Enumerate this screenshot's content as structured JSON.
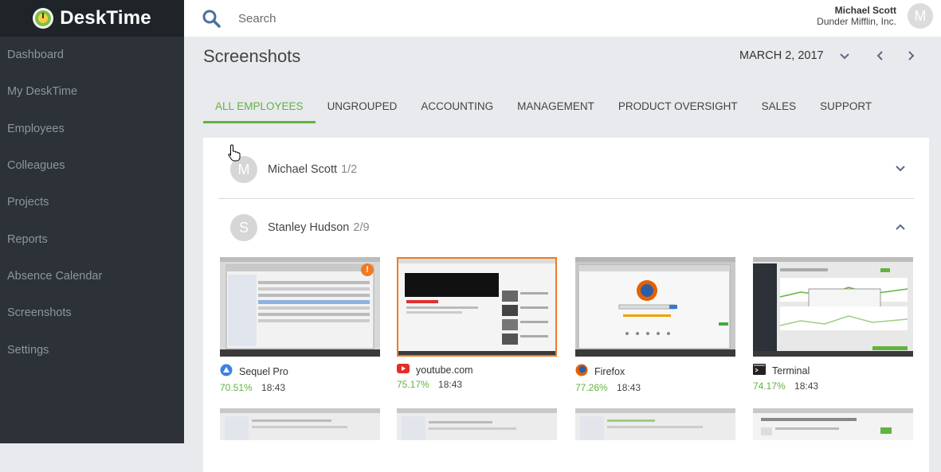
{
  "app": {
    "name": "DeskTime"
  },
  "sidebar": {
    "items": [
      {
        "label": "Dashboard"
      },
      {
        "label": "My DeskTime"
      },
      {
        "label": "Employees"
      },
      {
        "label": "Colleagues"
      },
      {
        "label": "Projects"
      },
      {
        "label": "Reports"
      },
      {
        "label": "Absence Calendar"
      },
      {
        "label": "Screenshots"
      },
      {
        "label": "Settings"
      }
    ]
  },
  "header": {
    "search_placeholder": "Search",
    "user_name": "Michael Scott",
    "company": "Dunder Mifflin, Inc.",
    "avatar_letter": "M"
  },
  "page": {
    "title": "Screenshots",
    "date": "MARCH 2, 2017"
  },
  "tabs": [
    {
      "label": "ALL EMPLOYEES",
      "active": true
    },
    {
      "label": "UNGROUPED"
    },
    {
      "label": "ACCOUNTING"
    },
    {
      "label": "MANAGEMENT"
    },
    {
      "label": "PRODUCT OVERSIGHT"
    },
    {
      "label": "SALES"
    },
    {
      "label": "SUPPORT"
    }
  ],
  "employees": [
    {
      "letter": "M",
      "name": "Michael Scott",
      "count": "1/2"
    },
    {
      "letter": "S",
      "name": "Stanley Hudson",
      "count": "2/9"
    }
  ],
  "screenshots": [
    {
      "app": "Sequel Pro",
      "percent": "70.51%",
      "time": "18:43",
      "icon": "sequel-pro-icon",
      "badge": "!"
    },
    {
      "app": "youtube.com",
      "percent": "75.17%",
      "time": "18:43",
      "icon": "youtube-icon"
    },
    {
      "app": "Firefox",
      "percent": "77.26%",
      "time": "18:43",
      "icon": "firefox-icon"
    },
    {
      "app": "Terminal",
      "percent": "74.17%",
      "time": "18:43",
      "icon": "terminal-icon"
    }
  ],
  "colors": {
    "accent": "#63b23f",
    "selected": "#f07a23",
    "sidebar": "#2c3237"
  }
}
